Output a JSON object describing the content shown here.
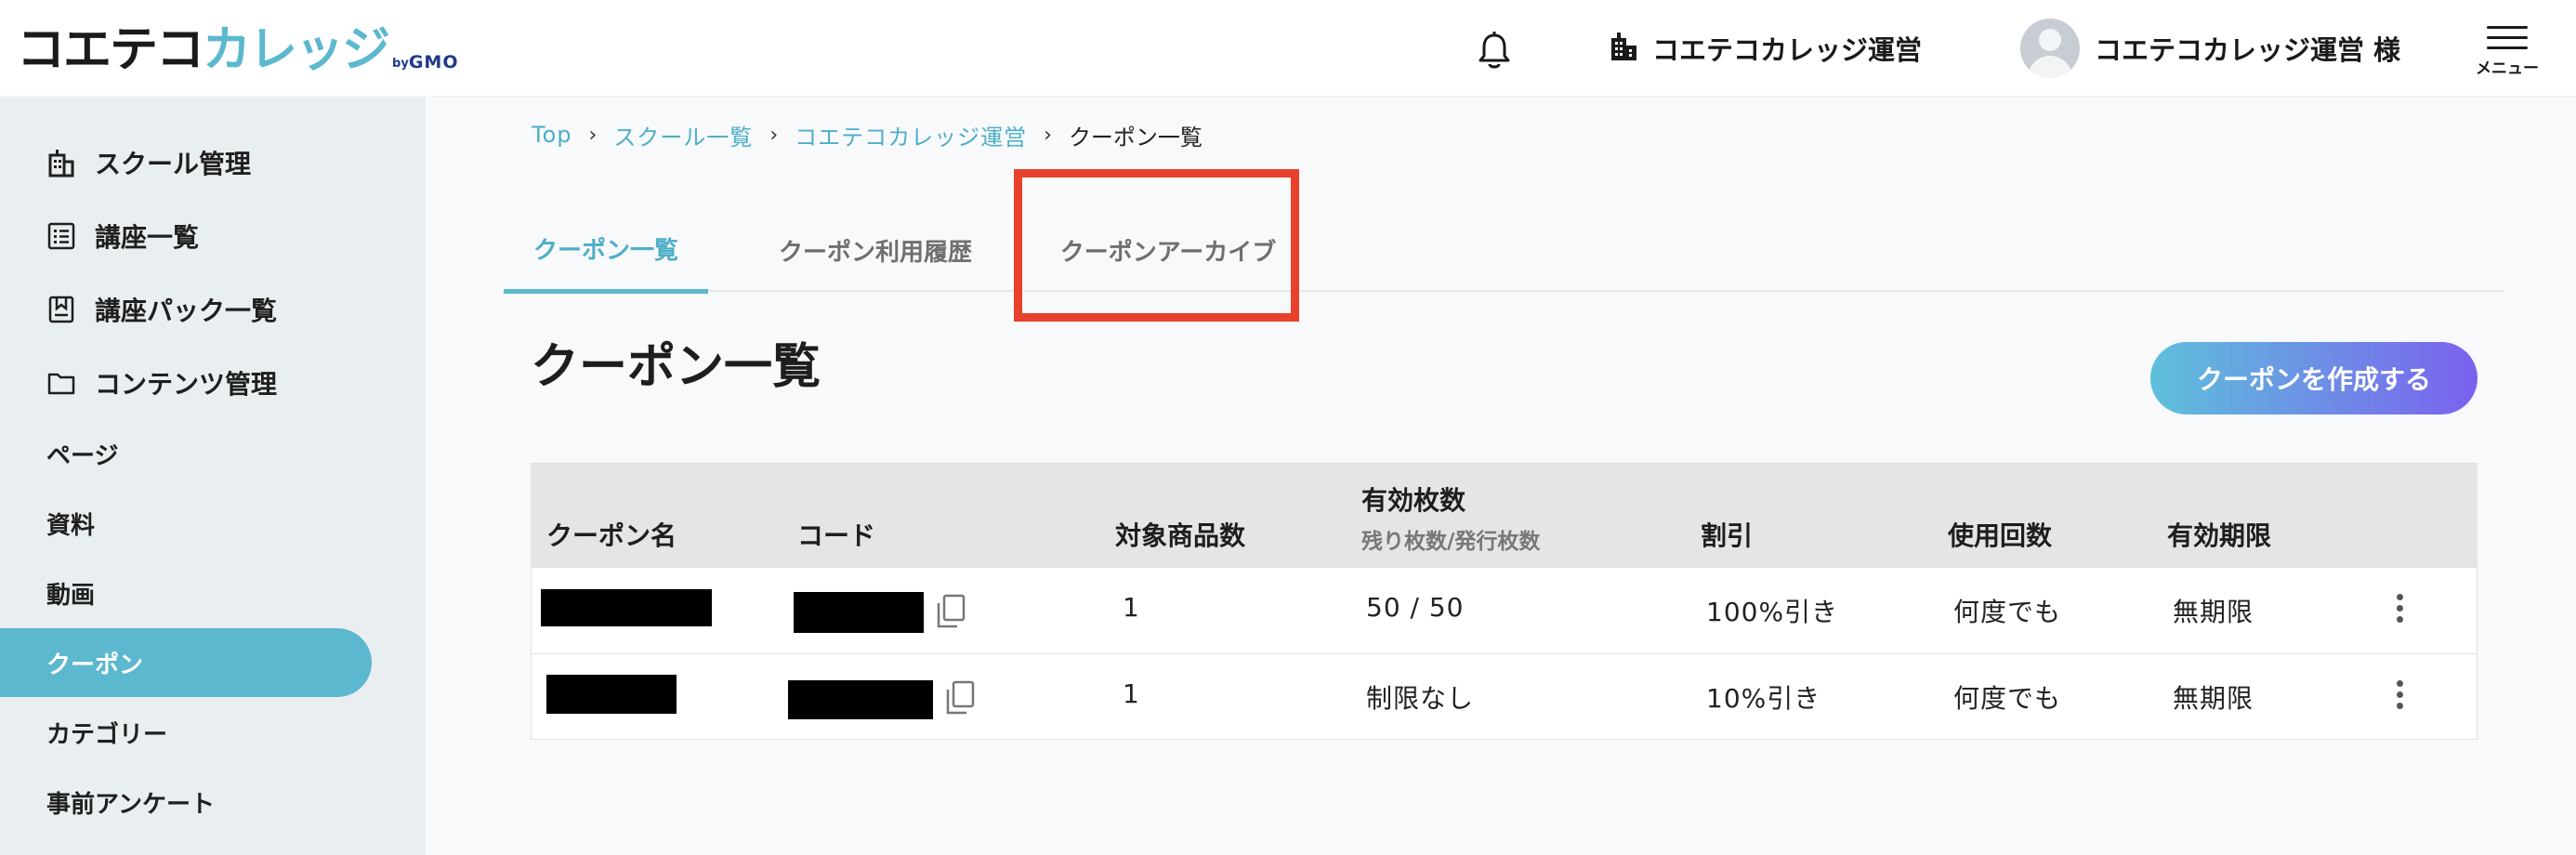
{
  "header": {
    "logo_main": "コエテコ",
    "logo_accent": "カレッジ",
    "logo_by": "by",
    "logo_gmo": "GMO",
    "school_name": "コエテコカレッジ運営",
    "user_name": "コエテコカレッジ運営",
    "user_suffix": "様",
    "menu_label": "メニュー"
  },
  "sidebar": {
    "items": [
      {
        "label": "スクール管理",
        "icon": "building-icon"
      },
      {
        "label": "講座一覧",
        "icon": "list-icon"
      },
      {
        "label": "講座パック一覧",
        "icon": "bookmark-icon"
      },
      {
        "label": "コンテンツ管理",
        "icon": "folder-icon"
      }
    ],
    "sub_items": [
      {
        "label": "ページ"
      },
      {
        "label": "資料"
      },
      {
        "label": "動画"
      },
      {
        "label": "クーポン",
        "active": true
      },
      {
        "label": "カテゴリー"
      },
      {
        "label": "事前アンケート"
      }
    ]
  },
  "breadcrumb": {
    "items": [
      "Top",
      "スクール一覧",
      "コエテコカレッジ運営"
    ],
    "current": "クーポン一覧"
  },
  "tabs": [
    {
      "label": "クーポン一覧",
      "active": true
    },
    {
      "label": "クーポン利用履歴",
      "active": false
    },
    {
      "label": "クーポンアーカイブ",
      "active": false
    }
  ],
  "page": {
    "title": "クーポン一覧",
    "create_button": "クーポンを作成する"
  },
  "table": {
    "headers": {
      "name": "クーポン名",
      "code": "コード",
      "products": "対象商品数",
      "valid_count": "有効枚数",
      "valid_count_sub": "残り枚数/発行枚数",
      "discount": "割引",
      "usage": "使用回数",
      "expiry": "有効期限"
    },
    "rows": [
      {
        "products": "1",
        "valid_count": "50 / 50",
        "discount": "100%引き",
        "usage": "何度でも",
        "expiry": "無期限"
      },
      {
        "products": "1",
        "valid_count": "制限なし",
        "discount": "10%引き",
        "usage": "何度でも",
        "expiry": "無期限"
      }
    ]
  },
  "colors": {
    "accent": "#5bb8cf",
    "highlight": "#e8412c",
    "button_gradient_start": "#5ec0dc",
    "button_gradient_end": "#7b61ee"
  }
}
